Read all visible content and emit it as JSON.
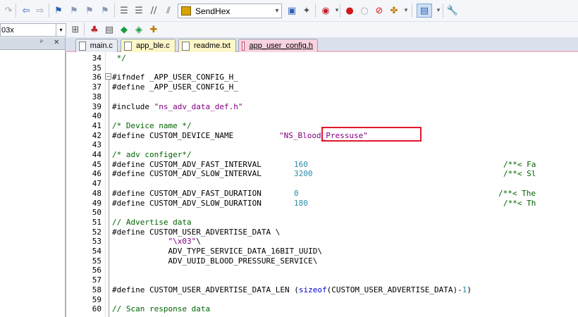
{
  "toolbar": {
    "send_combo_value": "SendHex"
  },
  "target": {
    "combo_value": "03x"
  },
  "tabs": [
    {
      "label": "main.c",
      "style": "plain"
    },
    {
      "label": "app_ble.c",
      "style": "yellow"
    },
    {
      "label": "readme.txt",
      "style": "yellow"
    },
    {
      "label": "app_user_config.h",
      "style": "active"
    }
  ],
  "editor": {
    "lines": [
      {
        "n": "34",
        "parts": [
          {
            "t": " */",
            "c": "com"
          }
        ]
      },
      {
        "n": "35",
        "parts": []
      },
      {
        "n": "36",
        "parts": [
          {
            "t": "#ifndef _APP_USER_CONFIG_H_",
            "c": ""
          }
        ]
      },
      {
        "n": "37",
        "parts": [
          {
            "t": "#define _APP_USER_CONFIG_H_",
            "c": ""
          }
        ]
      },
      {
        "n": "38",
        "parts": []
      },
      {
        "n": "39",
        "parts": [
          {
            "t": "#include ",
            "c": ""
          },
          {
            "t": "\"ns_adv_data_def.h\"",
            "c": "str"
          }
        ]
      },
      {
        "n": "40",
        "parts": []
      },
      {
        "n": "41",
        "parts": [
          {
            "t": "/* Device name */",
            "c": "com"
          }
        ]
      },
      {
        "n": "42",
        "parts": [
          {
            "t": "#define CUSTOM_DEVICE_NAME",
            "c": ""
          }
        ],
        "val": "\"NS_Blood_Pressuse\"",
        "valc": "str",
        "valx": 302
      },
      {
        "n": "43",
        "parts": []
      },
      {
        "n": "44",
        "parts": [
          {
            "t": "/* adv configer*/",
            "c": "com"
          }
        ]
      },
      {
        "n": "45",
        "parts": [
          {
            "t": "#define CUSTOM_ADV_FAST_INTERVAL",
            "c": ""
          }
        ],
        "val": "160",
        "valc": "num",
        "valx": 323,
        "cmt": "/**< Fa",
        "cmtx": 620
      },
      {
        "n": "46",
        "parts": [
          {
            "t": "#define CUSTOM_ADV_SLOW_INTERVAL",
            "c": ""
          }
        ],
        "val": "3200",
        "valc": "num",
        "valx": 323,
        "cmt": "/**< Sl",
        "cmtx": 620
      },
      {
        "n": "47",
        "parts": []
      },
      {
        "n": "48",
        "parts": [
          {
            "t": "#define CUSTOM_ADV_FAST_DURATION",
            "c": ""
          }
        ],
        "val": "0",
        "valc": "num",
        "valx": 323,
        "cmt": "/**< The",
        "cmtx": 613
      },
      {
        "n": "49",
        "parts": [
          {
            "t": "#define CUSTOM_ADV_SLOW_DURATION",
            "c": ""
          }
        ],
        "val": "180",
        "valc": "num",
        "valx": 323,
        "cmt": "/**< Th",
        "cmtx": 620
      },
      {
        "n": "50",
        "parts": []
      },
      {
        "n": "51",
        "parts": [
          {
            "t": "// Advertise data",
            "c": "com"
          }
        ]
      },
      {
        "n": "52",
        "parts": [
          {
            "t": "#define CUSTOM_USER_ADVERTISE_DATA \\",
            "c": ""
          }
        ]
      },
      {
        "n": "53",
        "parts": [
          {
            "t": "            ",
            "c": ""
          },
          {
            "t": "\"\\x03\"",
            "c": "str"
          },
          {
            "t": "\\",
            "c": ""
          }
        ]
      },
      {
        "n": "54",
        "parts": [
          {
            "t": "            ADV_TYPE_SERVICE_DATA_16BIT_UUID\\",
            "c": ""
          }
        ]
      },
      {
        "n": "55",
        "parts": [
          {
            "t": "            ADV_UUID_BLOOD_PRESSURE_SERVICE\\",
            "c": ""
          }
        ]
      },
      {
        "n": "56",
        "parts": []
      },
      {
        "n": "57",
        "parts": []
      },
      {
        "n": "58",
        "parts": [
          {
            "t": "#define CUSTOM_USER_ADVERTISE_DATA_LEN (",
            "c": ""
          },
          {
            "t": "sizeof",
            "c": "kw"
          },
          {
            "t": "(CUSTOM_USER_ADVERTISE_DATA)-",
            "c": ""
          },
          {
            "t": "1",
            "c": "num"
          },
          {
            "t": ")",
            "c": ""
          }
        ]
      },
      {
        "n": "59",
        "parts": []
      },
      {
        "n": "60",
        "parts": [
          {
            "t": "// Scan response data",
            "c": "com"
          }
        ]
      }
    ]
  }
}
